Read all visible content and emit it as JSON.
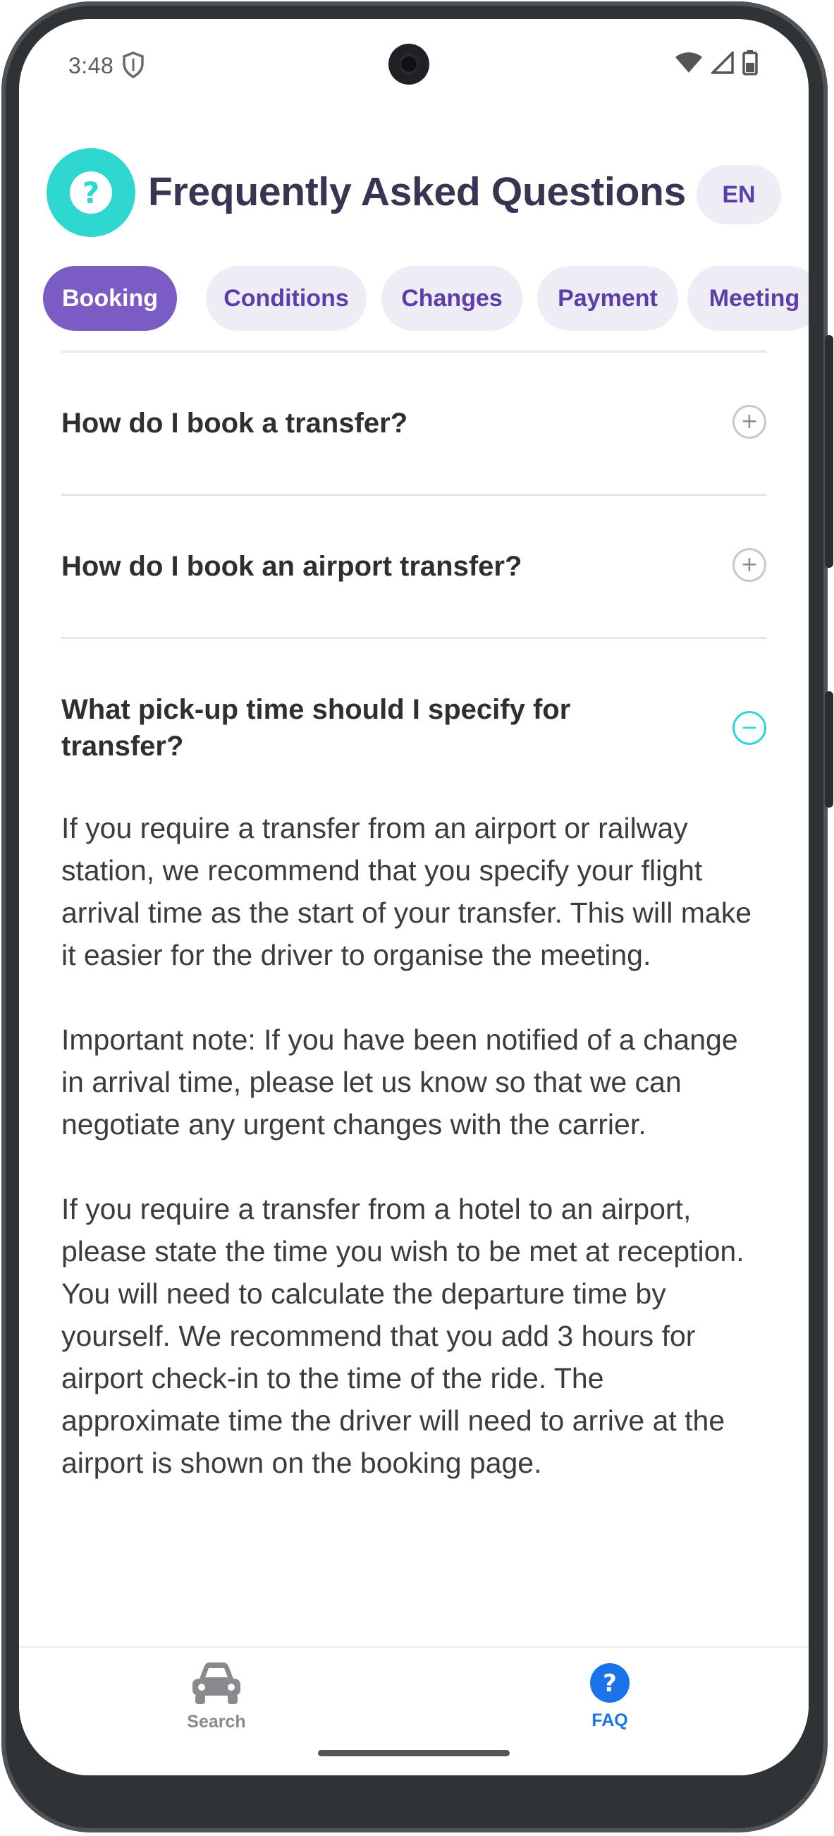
{
  "status_bar": {
    "time": "3:48",
    "icons": [
      "shield-icon",
      "wifi-icon",
      "signal-icon",
      "battery-icon"
    ]
  },
  "header": {
    "logo_icon": "question-mark-icon",
    "title": "Frequently Asked Questions",
    "language": "EN"
  },
  "tabs": [
    {
      "label": "Booking",
      "active": true
    },
    {
      "label": "Conditions",
      "active": false
    },
    {
      "label": "Changes",
      "active": false
    },
    {
      "label": "Payment",
      "active": false
    },
    {
      "label": "Meeting",
      "active": false
    }
  ],
  "faq": {
    "items": [
      {
        "question": "How do I book a transfer?",
        "expanded": false,
        "toggle": "+"
      },
      {
        "question": "How do I book an airport transfer?",
        "expanded": false,
        "toggle": "+"
      },
      {
        "question": "What pick-up time should I specify for transfer?",
        "expanded": true,
        "toggle": "−",
        "answer": [
          "If you require a transfer from an airport or railway station, we recommend that you specify your flight arrival time as the start of your transfer. This will make it easier for the driver to organise the meeting.",
          "Important note: If you have been notified of a change in arrival time, please let us know so that we can negotiate any urgent changes with the carrier.",
          "If you require a transfer from a hotel to an airport, please state the time you wish to be met at reception. You will need to calculate the departure time by yourself. We recommend that you add 3 hours for airport check-in to the time of the ride. The approximate time the driver will need to arrive at the airport is shown on the booking page."
        ]
      }
    ]
  },
  "bottom_nav": {
    "items": [
      {
        "label": "Search",
        "icon": "car-icon",
        "active": false
      },
      {
        "label": "FAQ",
        "icon": "help-circle-icon",
        "active": true
      }
    ]
  },
  "colors": {
    "accent": "#7b5cc4",
    "teal": "#2ed8d0",
    "tab_bg": "#eeedf6",
    "tab_text": "#5b3ea8",
    "nav_active": "#1a73e8",
    "nav_inactive": "#8a8a8e"
  }
}
